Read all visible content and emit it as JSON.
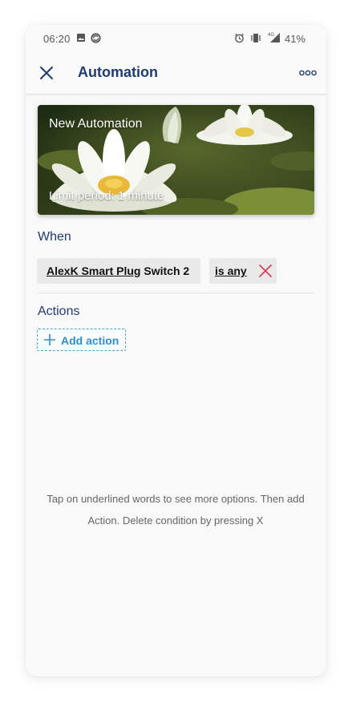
{
  "status_bar": {
    "time": "06:20",
    "battery": "41%",
    "icons": [
      "image-icon",
      "sync-icon",
      "alarm-icon",
      "vibrate-icon",
      "4g-signal-icon"
    ]
  },
  "app_bar": {
    "title": "Automation",
    "close_icon": "close-icon",
    "more_icon": "more-options-icon"
  },
  "hero": {
    "title": "New Automation",
    "subtitle": "Limit period: 1 minute",
    "image": "water-lily-photo"
  },
  "when": {
    "label": "When",
    "condition": {
      "device_underlined": "AlexK Smart Plug",
      "device_rest": " Switch 2",
      "operator": "is any",
      "delete_icon": "delete-x-icon"
    }
  },
  "actions": {
    "label": "Actions",
    "add_button": "Add action"
  },
  "hint": {
    "line1": "Tap on underlined words to see more options. Then add",
    "line2": "Action. Delete condition by pressing X"
  },
  "colors": {
    "title_blue": "#1f3b72",
    "accent_blue": "#2e8ecd",
    "delete_red": "#d63a5a"
  }
}
